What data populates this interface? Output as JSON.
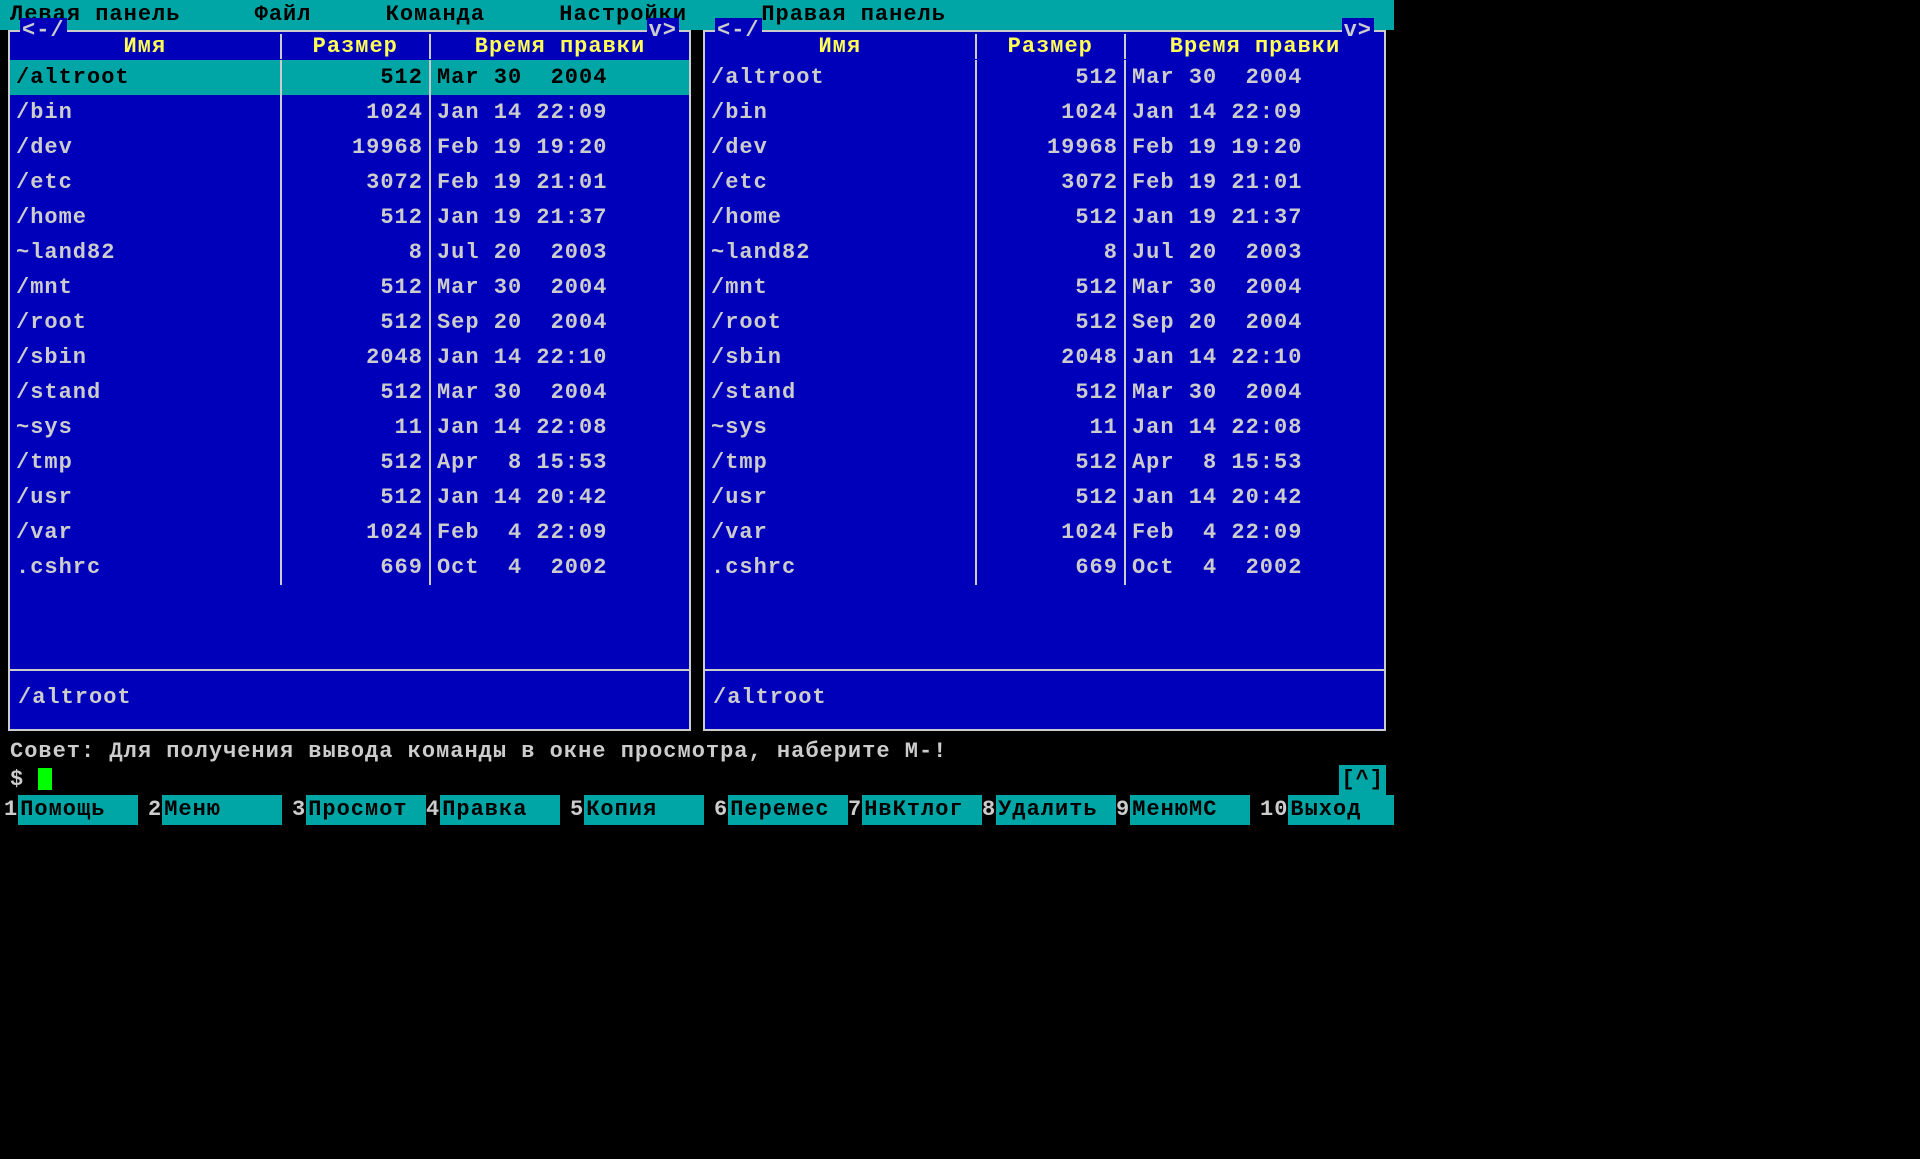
{
  "menu": {
    "left_panel": "Левая панель",
    "file": "Файл",
    "command": "Команда",
    "settings": "Настройки",
    "right_panel": "Правая панель"
  },
  "panel_headers": {
    "scroll_left": "<-/",
    "scroll_right": "v>",
    "col_name": "Имя",
    "col_size": "Размер",
    "col_time": "Время правки"
  },
  "left_panel": {
    "selected_index": 0,
    "status": "/altroot",
    "files": [
      {
        "name": "/altroot",
        "size": "512",
        "time": "Mar 30  2004"
      },
      {
        "name": "/bin",
        "size": "1024",
        "time": "Jan 14 22:09"
      },
      {
        "name": "/dev",
        "size": "19968",
        "time": "Feb 19 19:20"
      },
      {
        "name": "/etc",
        "size": "3072",
        "time": "Feb 19 21:01"
      },
      {
        "name": "/home",
        "size": "512",
        "time": "Jan 19 21:37"
      },
      {
        "name": "~land82",
        "size": "8",
        "time": "Jul 20  2003"
      },
      {
        "name": "/mnt",
        "size": "512",
        "time": "Mar 30  2004"
      },
      {
        "name": "/root",
        "size": "512",
        "time": "Sep 20  2004"
      },
      {
        "name": "/sbin",
        "size": "2048",
        "time": "Jan 14 22:10"
      },
      {
        "name": "/stand",
        "size": "512",
        "time": "Mar 30  2004"
      },
      {
        "name": "~sys",
        "size": "11",
        "time": "Jan 14 22:08"
      },
      {
        "name": "/tmp",
        "size": "512",
        "time": "Apr  8 15:53"
      },
      {
        "name": "/usr",
        "size": "512",
        "time": "Jan 14 20:42"
      },
      {
        "name": "/var",
        "size": "1024",
        "time": "Feb  4 22:09"
      },
      {
        "name": " .cshrc",
        "size": "669",
        "time": "Oct  4  2002"
      }
    ]
  },
  "right_panel": {
    "selected_index": -1,
    "status": "/altroot",
    "files": [
      {
        "name": "/altroot",
        "size": "512",
        "time": "Mar 30  2004"
      },
      {
        "name": "/bin",
        "size": "1024",
        "time": "Jan 14 22:09"
      },
      {
        "name": "/dev",
        "size": "19968",
        "time": "Feb 19 19:20"
      },
      {
        "name": "/etc",
        "size": "3072",
        "time": "Feb 19 21:01"
      },
      {
        "name": "/home",
        "size": "512",
        "time": "Jan 19 21:37"
      },
      {
        "name": "~land82",
        "size": "8",
        "time": "Jul 20  2003"
      },
      {
        "name": "/mnt",
        "size": "512",
        "time": "Mar 30  2004"
      },
      {
        "name": "/root",
        "size": "512",
        "time": "Sep 20  2004"
      },
      {
        "name": "/sbin",
        "size": "2048",
        "time": "Jan 14 22:10"
      },
      {
        "name": "/stand",
        "size": "512",
        "time": "Mar 30  2004"
      },
      {
        "name": "~sys",
        "size": "11",
        "time": "Jan 14 22:08"
      },
      {
        "name": "/tmp",
        "size": "512",
        "time": "Apr  8 15:53"
      },
      {
        "name": "/usr",
        "size": "512",
        "time": "Jan 14 20:42"
      },
      {
        "name": "/var",
        "size": "1024",
        "time": "Feb  4 22:09"
      },
      {
        "name": " .cshrc",
        "size": "669",
        "time": "Oct  4  2002"
      }
    ]
  },
  "hint": "Совет: Для получения вывода команды в окне просмотра, наберите M-!",
  "prompt": "$ ",
  "caret_indicator": "[^]",
  "fkeys": [
    {
      "num": "1",
      "label": "Помощь"
    },
    {
      "num": "2",
      "label": "Меню"
    },
    {
      "num": "3",
      "label": "Просмот"
    },
    {
      "num": "4",
      "label": "Правка"
    },
    {
      "num": "5",
      "label": "Копия"
    },
    {
      "num": "6",
      "label": "Перемес"
    },
    {
      "num": "7",
      "label": "НвКтлог"
    },
    {
      "num": "8",
      "label": "Удалить"
    },
    {
      "num": "9",
      "label": "МенюMC"
    },
    {
      "num": "10",
      "label": "Выход"
    }
  ]
}
